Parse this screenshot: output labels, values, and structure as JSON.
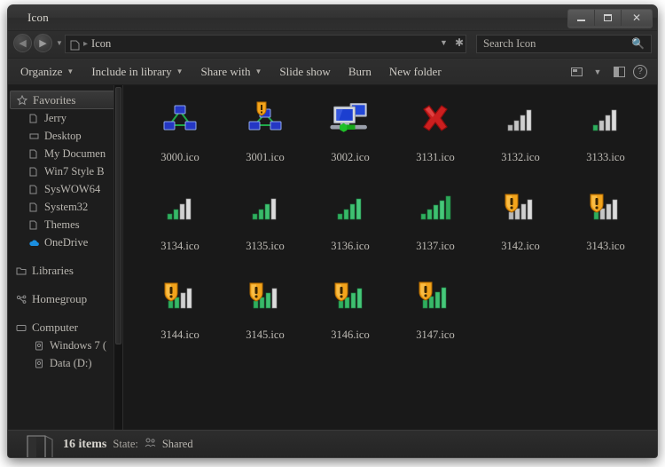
{
  "window": {
    "title": "Icon",
    "controls": {
      "minimize": "Minimize",
      "maximize": "Maximize",
      "close": "Close"
    }
  },
  "address_bar": {
    "back_label": "Back",
    "forward_label": "Forward",
    "history_label": "Recent pages",
    "path_separator": "▸",
    "path_text": "Icon",
    "previous_locations_label": "Previous locations",
    "refresh_label": "Refresh"
  },
  "search": {
    "placeholder": "Search Icon",
    "icon": "search-icon"
  },
  "toolbar": {
    "items": [
      {
        "label": "Organize",
        "has_menu": true
      },
      {
        "label": "Include in library",
        "has_menu": true
      },
      {
        "label": "Share with",
        "has_menu": true
      },
      {
        "label": "Slide show",
        "has_menu": false
      },
      {
        "label": "Burn",
        "has_menu": false
      },
      {
        "label": "New folder",
        "has_menu": false
      }
    ],
    "view_button": "change-view-button",
    "view_dropdown": "view-dropdown-caret",
    "preview_pane_button": "preview-pane-button",
    "help_button": "help-button"
  },
  "sidebar": {
    "groups": [
      {
        "header": {
          "label": "Favorites",
          "icon": "star-icon",
          "selected": true
        },
        "items": [
          {
            "label": "Jerry",
            "icon": "folder-icon"
          },
          {
            "label": "Desktop",
            "icon": "desktop-icon"
          },
          {
            "label": "My Documen",
            "icon": "folder-icon"
          },
          {
            "label": "Win7 Style B",
            "icon": "folder-icon"
          },
          {
            "label": "SysWOW64",
            "icon": "folder-icon"
          },
          {
            "label": "System32",
            "icon": "folder-icon"
          },
          {
            "label": "Themes",
            "icon": "folder-icon"
          },
          {
            "label": "OneDrive",
            "icon": "onedrive-cloud-icon"
          }
        ]
      },
      {
        "header": {
          "label": "Libraries",
          "icon": "libraries-icon",
          "selected": false
        },
        "items": []
      },
      {
        "header": {
          "label": "Homegroup",
          "icon": "homegroup-icon",
          "selected": false
        },
        "items": []
      },
      {
        "header": {
          "label": "Computer",
          "icon": "computer-icon",
          "selected": false
        },
        "items": [
          {
            "label": "Windows 7 (",
            "icon": "drive-icon"
          },
          {
            "label": "Data (D:)",
            "icon": "drive-icon"
          }
        ]
      }
    ],
    "scrollbar": "sidebar-scrollbar"
  },
  "files": [
    {
      "name": "3000.ico",
      "icon": "network-diagram-icon"
    },
    {
      "name": "3001.ico",
      "icon": "network-diagram-warning-icon"
    },
    {
      "name": "3002.ico",
      "icon": "two-monitors-network-icon"
    },
    {
      "name": "3131.ico",
      "icon": "red-x-icon"
    },
    {
      "name": "3132.ico",
      "icon": "signal-bars-0-icon"
    },
    {
      "name": "3133.ico",
      "icon": "signal-bars-1-icon"
    },
    {
      "name": "3134.ico",
      "icon": "signal-bars-2-icon"
    },
    {
      "name": "3135.ico",
      "icon": "signal-bars-3-icon"
    },
    {
      "name": "3136.ico",
      "icon": "signal-bars-4-icon"
    },
    {
      "name": "3137.ico",
      "icon": "signal-bars-5-icon"
    },
    {
      "name": "3142.ico",
      "icon": "shield-warning-signal-0-icon"
    },
    {
      "name": "3143.ico",
      "icon": "shield-warning-signal-1-icon"
    },
    {
      "name": "3144.ico",
      "icon": "shield-warning-signal-2-icon"
    },
    {
      "name": "3145.ico",
      "icon": "shield-warning-signal-3-icon"
    },
    {
      "name": "3146.ico",
      "icon": "shield-warning-signal-4-icon"
    },
    {
      "name": "3147.ico",
      "icon": "shield-warning-signal-5-icon"
    }
  ],
  "status_bar": {
    "item_count": "16 items",
    "state_label": "State:",
    "state_value": "Shared",
    "state_icon": "shared-people-icon",
    "folder_icon": "folder-large-icon"
  },
  "colors": {
    "window_chrome": "#2b2b2b",
    "content_background": "#191919",
    "sidebar_background": "#1d1d1d",
    "text_primary": "#cdcac4",
    "signal_green": "#2fae5e",
    "signal_gray": "#c9c9c9",
    "shield_orange": "#f0a11e",
    "red_x": "#cc2222",
    "monitor_blue": "#1f38c8"
  }
}
